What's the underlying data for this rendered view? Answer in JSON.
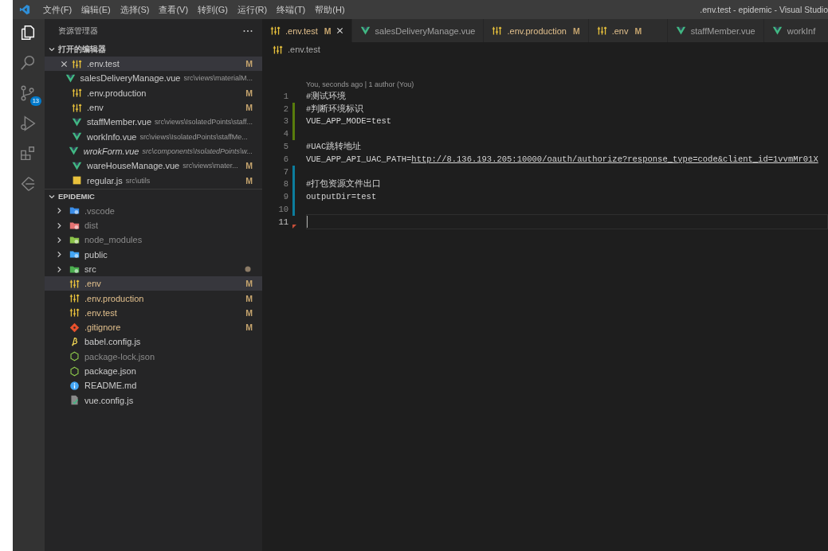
{
  "window": {
    "title": ".env.test - epidemic - Visual Studio"
  },
  "menu": [
    "文件(F)",
    "编辑(E)",
    "选择(S)",
    "查看(V)",
    "转到(G)",
    "运行(R)",
    "终端(T)",
    "帮助(H)"
  ],
  "activity_bar": [
    {
      "kind": "explorer",
      "selected": true
    },
    {
      "kind": "search",
      "selected": false
    },
    {
      "kind": "source-control",
      "selected": false,
      "badge": "13"
    },
    {
      "kind": "run",
      "selected": false
    },
    {
      "kind": "extensions",
      "selected": false
    },
    {
      "kind": "timeline",
      "selected": false
    }
  ],
  "sidebar": {
    "title": "资源管理器",
    "open_editors": {
      "title": "打开的编辑器",
      "expanded": true,
      "items": [
        {
          "name": ".env.test",
          "kind": "env",
          "status": "M",
          "selected": true,
          "italic": false
        },
        {
          "name": "salesDeliveryManage.vue",
          "path": "src\\views\\materialM...",
          "kind": "vue",
          "selected": false,
          "italic": false
        },
        {
          "name": ".env.production",
          "kind": "env",
          "status": "M",
          "selected": false,
          "italic": false
        },
        {
          "name": ".env",
          "kind": "env",
          "status": "M",
          "selected": false,
          "italic": false
        },
        {
          "name": "staffMember.vue",
          "path": "src\\views\\IsolatedPoints\\staff...",
          "kind": "vue",
          "selected": false,
          "italic": false
        },
        {
          "name": "workInfo.vue",
          "path": "src\\views\\IsolatedPoints\\staffMe...",
          "kind": "vue",
          "selected": false,
          "italic": false
        },
        {
          "name": "wrokForm.vue",
          "path": "src\\components\\IsolatedPoints\\w...",
          "kind": "vue",
          "selected": false,
          "italic": true
        },
        {
          "name": "wareHouseManage.vue",
          "path": "src\\views\\mater...",
          "kind": "vue",
          "status": "M",
          "selected": false,
          "italic": false
        },
        {
          "name": "regular.js",
          "path": "src\\utils",
          "kind": "js",
          "status": "M",
          "selected": false,
          "italic": false
        }
      ]
    },
    "project": {
      "title": "EPIDEMIC",
      "expanded": true,
      "items": [
        {
          "name": ".vscode",
          "kind": "folder-vscode",
          "expanded": false,
          "dimmed": true,
          "selected": false
        },
        {
          "name": "dist",
          "kind": "folder-dist",
          "expanded": false,
          "dimmed": true,
          "selected": false
        },
        {
          "name": "node_modules",
          "kind": "folder-node",
          "expanded": false,
          "dimmed": true,
          "selected": false
        },
        {
          "name": "public",
          "kind": "folder-public",
          "expanded": false,
          "dimmed": false,
          "selected": false
        },
        {
          "name": "src",
          "kind": "folder-src",
          "expanded": false,
          "dimmed": false,
          "selected": false,
          "changes_inside": true
        },
        {
          "name": ".env",
          "kind": "env",
          "status": "M",
          "dimmed": false,
          "selected": true
        },
        {
          "name": ".env.production",
          "kind": "env",
          "status": "M",
          "dimmed": false,
          "selected": false
        },
        {
          "name": ".env.test",
          "kind": "env",
          "status": "M",
          "dimmed": false,
          "selected": false
        },
        {
          "name": ".gitignore",
          "kind": "git",
          "status": "M",
          "dimmed": false,
          "selected": false
        },
        {
          "name": "babel.config.js",
          "kind": "babel",
          "dimmed": false,
          "selected": false
        },
        {
          "name": "package-lock.json",
          "kind": "node",
          "dimmed": true,
          "selected": false
        },
        {
          "name": "package.json",
          "kind": "node",
          "dimmed": false,
          "selected": false
        },
        {
          "name": "README.md",
          "kind": "info",
          "dimmed": false,
          "selected": false
        },
        {
          "name": "vue.config.js",
          "kind": "vueconfig",
          "dimmed": false,
          "selected": false
        }
      ]
    }
  },
  "tabs": [
    {
      "label": ".env.test",
      "kind": "env",
      "status": "M",
      "selected": true
    },
    {
      "label": "salesDeliveryManage.vue",
      "kind": "vue",
      "selected": false
    },
    {
      "label": ".env.production",
      "kind": "env",
      "status": "M",
      "selected": false
    },
    {
      "label": ".env",
      "kind": "env",
      "status": "M",
      "selected": false
    },
    {
      "label": "staffMember.vue",
      "kind": "vue",
      "selected": false
    },
    {
      "label": "workInf",
      "kind": "vue",
      "selected": false
    }
  ],
  "breadcrumb": {
    "kind": "env",
    "label": ".env.test"
  },
  "editor": {
    "codelens": "You, seconds ago | 1 author (You)",
    "lines": [
      {
        "number": "1",
        "kind": "plain",
        "segments": [
          {
            "kind": "comment",
            "text": "#测试环境"
          }
        ],
        "current": false
      },
      {
        "number": "2",
        "kind": "added",
        "segments": [
          {
            "kind": "comment",
            "text": "#判断环境标识"
          }
        ],
        "current": false
      },
      {
        "number": "3",
        "kind": "added",
        "segments": [
          {
            "kind": "text",
            "text": "VUE_APP_MODE=test"
          }
        ],
        "current": false
      },
      {
        "number": "4",
        "kind": "added",
        "current": false
      },
      {
        "number": "5",
        "kind": "plain",
        "segments": [
          {
            "kind": "comment",
            "text": "#UAC跳转地址"
          }
        ],
        "current": false
      },
      {
        "number": "6",
        "kind": "plain",
        "segments": [
          {
            "kind": "text",
            "text": "VUE_APP_API_UAC_PATH="
          },
          {
            "kind": "link",
            "text": "http://8.136.193.205:10000/oauth/authorize?response_type=code&client_id=1vvmMr01X"
          }
        ],
        "current": false
      },
      {
        "number": "7",
        "kind": "modified",
        "current": false
      },
      {
        "number": "8",
        "kind": "modified",
        "segments": [
          {
            "kind": "comment",
            "text": "#打包资源文件出口"
          }
        ],
        "current": false
      },
      {
        "number": "9",
        "kind": "modified",
        "segments": [
          {
            "kind": "text",
            "text": "outputDir=test"
          }
        ],
        "current": false
      },
      {
        "number": "10",
        "kind": "modified",
        "current": false
      },
      {
        "number": "11",
        "kind": "deleted",
        "current": true
      }
    ]
  }
}
